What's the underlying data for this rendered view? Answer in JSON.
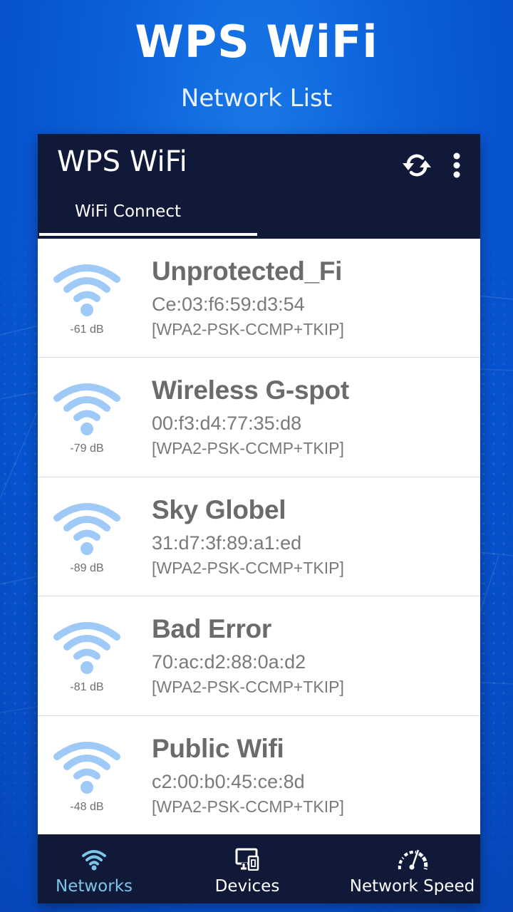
{
  "promo": {
    "title": "WPS WiFi",
    "subtitle": "Network List"
  },
  "appbar": {
    "title": "WPS WiFi",
    "refresh_icon": "refresh-icon",
    "more_icon": "more-vertical-icon",
    "tabs": [
      {
        "label": "WiFi Connect",
        "active": true
      }
    ]
  },
  "networks": [
    {
      "ssid": "Unprotected_Fi",
      "bssid": "Ce:03:f6:59:d3:54",
      "security": "[WPA2-PSK-CCMP+TKIP]",
      "signal": "-61 dB",
      "icon": "wifi-icon"
    },
    {
      "ssid": "Wireless G-spot",
      "bssid": "00:f3:d4:77:35:d8",
      "security": "[WPA2-PSK-CCMP+TKIP]",
      "signal": "-79 dB",
      "icon": "wifi-icon"
    },
    {
      "ssid": "Sky Globel",
      "bssid": "31:d7:3f:89:a1:ed",
      "security": "[WPA2-PSK-CCMP+TKIP]",
      "signal": "-89 dB",
      "icon": "wifi-icon"
    },
    {
      "ssid": "Bad Error",
      "bssid": "70:ac:d2:88:0a:d2",
      "security": "[WPA2-PSK-CCMP+TKIP]",
      "signal": "-81 dB",
      "icon": "wifi-icon"
    },
    {
      "ssid": "Public Wifi",
      "bssid": "c2:00:b0:45:ce:8d",
      "security": "[WPA2-PSK-CCMP+TKIP]",
      "signal": "-48 dB",
      "icon": "wifi-icon"
    }
  ],
  "bottom_nav": {
    "items": [
      {
        "label": "Networks",
        "icon": "wifi-icon",
        "active": true
      },
      {
        "label": "Devices",
        "icon": "devices-icon",
        "active": false
      },
      {
        "label": "Network Speed",
        "icon": "speedometer-icon",
        "active": false
      }
    ]
  },
  "colors": {
    "background_blue": "#0d63dc",
    "appbar_navy": "#101a38",
    "wifi_icon_blue": "#9fcaf8",
    "active_nav": "#7cc6ea",
    "text_gray": "#6b6b6b"
  }
}
